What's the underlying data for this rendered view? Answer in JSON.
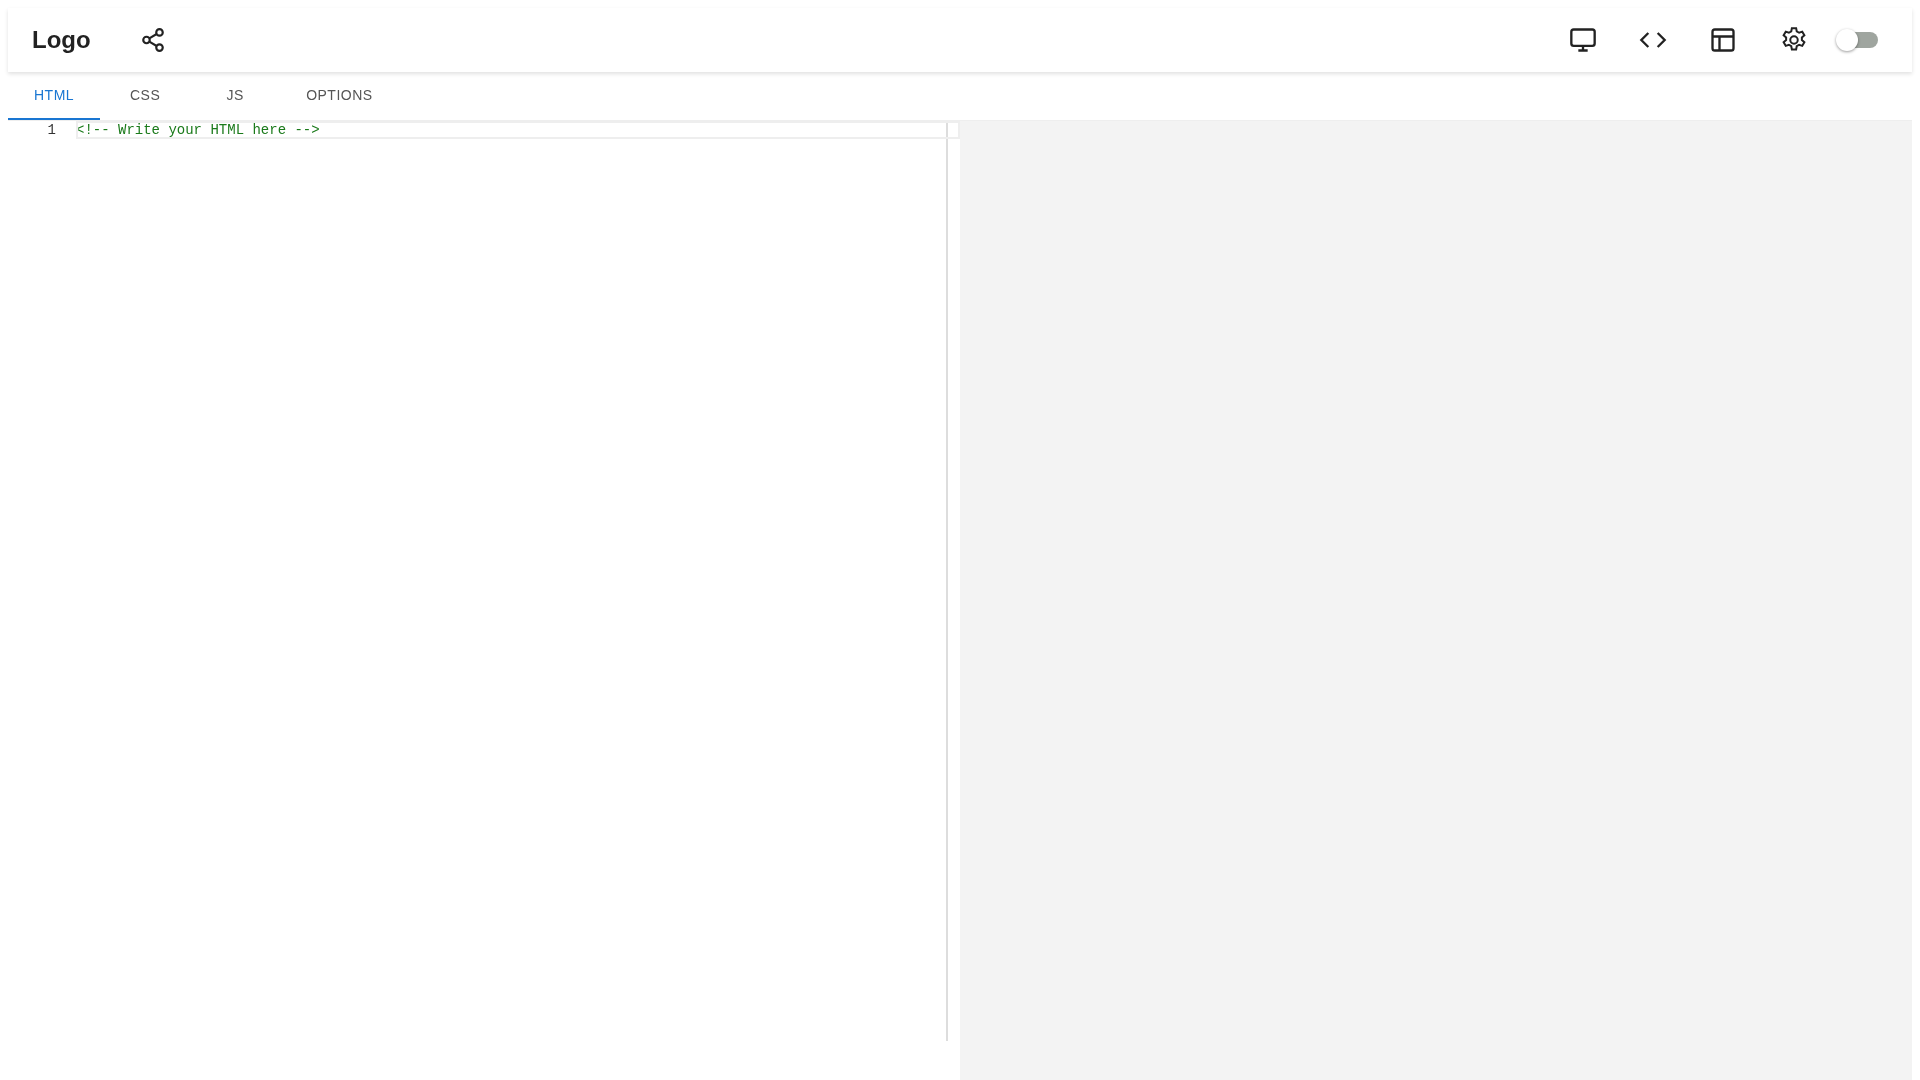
{
  "header": {
    "logo": "Logo",
    "toggle": {
      "on": false
    }
  },
  "tabs": [
    {
      "label": "HTML",
      "selected": true
    },
    {
      "label": "CSS",
      "selected": false
    },
    {
      "label": "JS",
      "selected": false
    },
    {
      "label": "OPTIONS",
      "selected": false
    }
  ],
  "editor": {
    "lines": [
      {
        "number": "1",
        "code": "<!-- Write your HTML here -->"
      }
    ]
  }
}
